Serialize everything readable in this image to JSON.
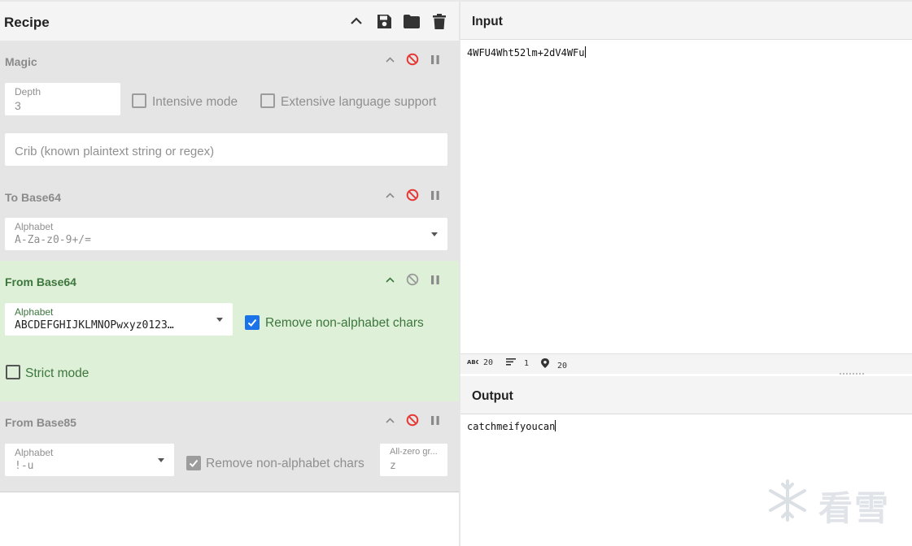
{
  "recipe": {
    "title": "Recipe",
    "header_icons": [
      "chevron-up-icon",
      "save-icon",
      "folder-icon",
      "trash-icon"
    ],
    "ops": [
      {
        "name": "Magic",
        "depth_label": "Depth",
        "depth_value": "3",
        "intensive_label": "Intensive mode",
        "intensive_checked": false,
        "extensive_label": "Extensive language support",
        "extensive_checked": false,
        "crib_placeholder": "Crib (known plaintext string or regex)"
      },
      {
        "name": "To Base64",
        "alphabet_label": "Alphabet",
        "alphabet_value": "A-Za-z0-9+/="
      },
      {
        "name": "From Base64",
        "alphabet_label": "Alphabet",
        "alphabet_value": "ABCDEFGHIJKLMNOPwxyz0123…",
        "remove_label": "Remove non-alphabet chars",
        "remove_checked": true,
        "strict_label": "Strict mode",
        "strict_checked": false
      },
      {
        "name": "From Base85",
        "alphabet_label": "Alphabet",
        "alphabet_value": "!-u",
        "remove_label": "Remove non-alphabet chars",
        "remove_checked": true,
        "allzero_label": "All-zero gr...",
        "allzero_value": "z"
      }
    ]
  },
  "input": {
    "title": "Input",
    "text": "4WFU4Wht52lm+2dV4WFu"
  },
  "status": {
    "length": "20",
    "lines": "1",
    "position": "20"
  },
  "output": {
    "title": "Output",
    "text": "catchmeifyoucan"
  },
  "watermark": "看雪",
  "colors": {
    "accent_blue": "#1a73e8",
    "active_op_bg": "#dff0d8",
    "active_op_text": "#3c763d",
    "disable_red": "#e53935",
    "op_bg": "#e5e5e5"
  }
}
